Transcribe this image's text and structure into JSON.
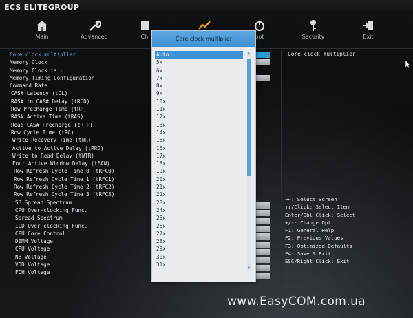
{
  "brand": "ECS ELITEGROUP",
  "tabs": [
    {
      "label": "Main",
      "icon": "home-icon"
    },
    {
      "label": "Advanced",
      "icon": "wrench-icon"
    },
    {
      "label": "Chi",
      "icon": "chip-icon"
    },
    {
      "label": "",
      "icon": "chart-icon"
    },
    {
      "label": "oot",
      "icon": "power-icon"
    },
    {
      "label": "Security",
      "icon": "key-icon"
    },
    {
      "label": "Exit",
      "icon": "exit-icon"
    }
  ],
  "left_items": [
    "Core clock multiplier",
    "Memory Clock",
    "Memory Clock is :",
    "Memory Timing Configuration",
    "Command Rate",
    "CAS# Latency (tCL)",
    "RAS# to CAS# Delay (tRCD)",
    "Row Precharge Time (tRP)",
    "RAS# Active Time (tRAS)",
    "Read CAS# Precharge (tRTP)",
    "Row Cycle Time (tRC)",
    "Write Recovery Time (tWR)",
    "Active to Active Delay (tRRD)",
    "Write to Read Delay (tWTR)",
    "Four Active Window Delay (tFAW)",
    "Row Refresh Cycle Time 0 (tRFC0)",
    "Row Refresh Cycle Time 1 (tRFC1)",
    "Row Refresh Cycle Time 2 (tRFC2)",
    "Row Refresh Cycle Time 3 (tRFC3)",
    "SB Spread Spectrum",
    "CPU Over-clocking Func.",
    "Spread Spectrum",
    "IGD Over-clocking Func.",
    "CPU Core Control",
    "DIMM Voltage",
    "CPU Voltage",
    "NB Voltage",
    "VDD Voltage",
    "FCH Voltage"
  ],
  "popup": {
    "title": "Core clock multiplier",
    "options": [
      "Auto",
      "5x",
      "6x",
      "7x",
      "8x",
      "9x",
      "10x",
      "11x",
      "12x",
      "13x",
      "14x",
      "15x",
      "16x",
      "17x",
      "18x",
      "19x",
      "20x",
      "21x",
      "22x",
      "23x",
      "24x",
      "25x",
      "26x",
      "27x",
      "28x",
      "29x",
      "30x",
      "31x"
    ],
    "selected": "Auto"
  },
  "help_title": "Core clock multiplier",
  "keys": [
    "→←: Select Screen",
    "↑↓/Click: Select Item",
    "Enter/Dbl Click: Select",
    "+/-: Change Opt.",
    "F1: General Help",
    "F2: Previous Values",
    "F3: Optimized Defaults",
    "F4: Save & Exit",
    "ESC/Right Click: Exit"
  ],
  "watermark": "www.EasyCOM.com.ua",
  "colors": {
    "accent": "#3e92d6",
    "selected_text": "#59b8ec"
  }
}
